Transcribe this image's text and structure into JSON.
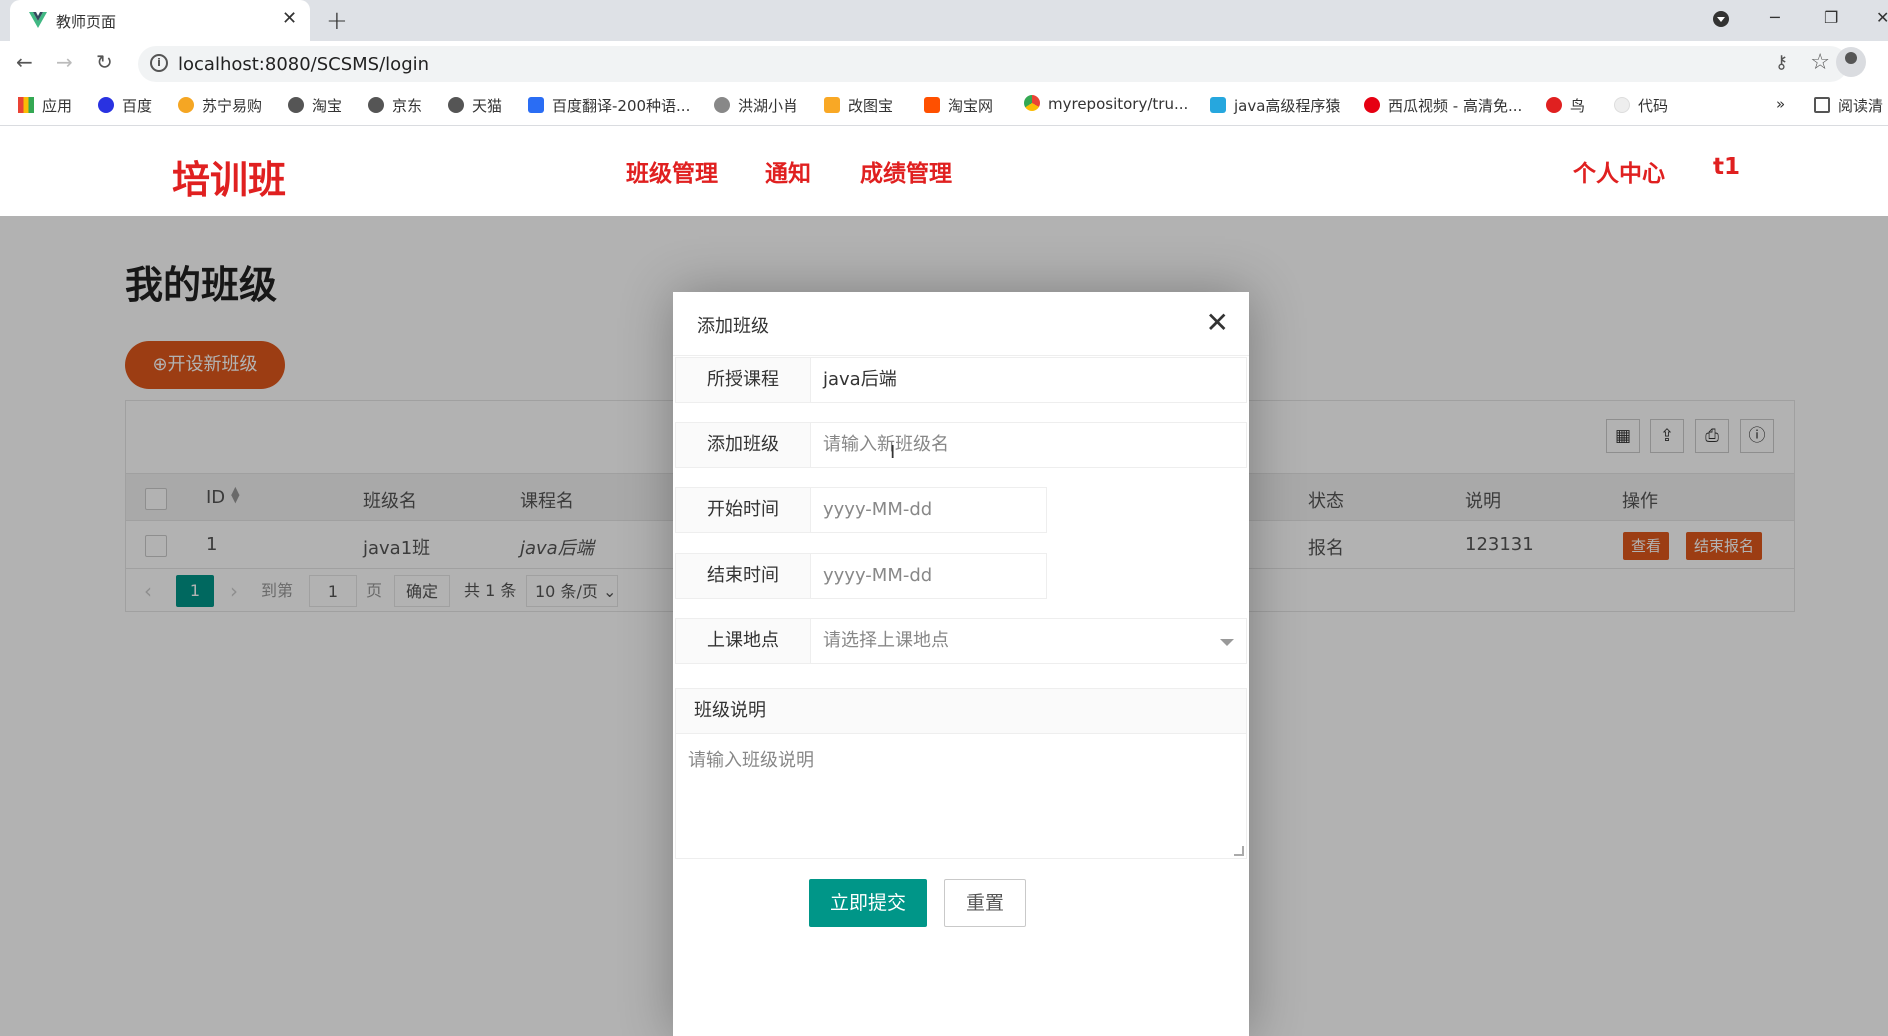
{
  "browser": {
    "tab_title": "教师页面",
    "url": "localhost:8080/SCSMS/login",
    "bookmarks": [
      "应用",
      "百度",
      "苏宁易购",
      "淘宝",
      "京东",
      "天猫",
      "百度翻译-200种语...",
      "洪湖小肖",
      "改图宝",
      "淘宝网",
      "myrepository/tru...",
      "java高级程序猿",
      "西瓜视频 - 高清免...",
      "鸟",
      "代码",
      "»",
      "阅读清"
    ],
    "bookmark_colors": [
      "#4285f4",
      "#2932e1",
      "#f5a623",
      "#555555",
      "#555555",
      "#555555",
      "#2a6df4",
      "#888888",
      "#f9a825",
      "#ff5000",
      "#555555",
      "#26a7de",
      "#e60012",
      "#e02020",
      "#dddddd",
      "#333333",
      "#555555"
    ]
  },
  "header": {
    "brand": "培训班",
    "nav": [
      "班级管理",
      "通知",
      "成绩管理"
    ],
    "profile": "个人中心",
    "user": "t1"
  },
  "main": {
    "page_title": "我的班级",
    "new_class_button": "开设新班级",
    "columns": [
      "ID",
      "班级名",
      "课程名",
      "状态",
      "说明",
      "操作"
    ],
    "rows": [
      {
        "id": "1",
        "class_name": "java1班",
        "course": "java后端",
        "status": "报名",
        "desc": "123131"
      }
    ],
    "row_actions": [
      "查看",
      "结束报名"
    ],
    "pager": {
      "current": "1",
      "goto_label": "到第",
      "page_input": "1",
      "page_suffix": "页",
      "confirm": "确定",
      "total": "共 1 条",
      "page_size": "10 条/页"
    }
  },
  "modal": {
    "title": "添加班级",
    "fields": [
      {
        "label": "所授课程",
        "value": "java后端",
        "placeholder": ""
      },
      {
        "label": "添加班级",
        "value": "",
        "placeholder": "请输入新班级名"
      },
      {
        "label": "开始时间",
        "value": "",
        "placeholder": "yyyy-MM-dd"
      },
      {
        "label": "结束时间",
        "value": "",
        "placeholder": "yyyy-MM-dd"
      },
      {
        "label": "上课地点",
        "value": "",
        "placeholder": "请选择上课地点"
      }
    ],
    "desc_label": "班级说明",
    "desc_placeholder": "请输入班级说明",
    "submit": "立即提交",
    "reset": "重置"
  },
  "colors": {
    "brand_red": "#e02020",
    "accent_orange": "#e0581c",
    "teal": "#009688"
  }
}
